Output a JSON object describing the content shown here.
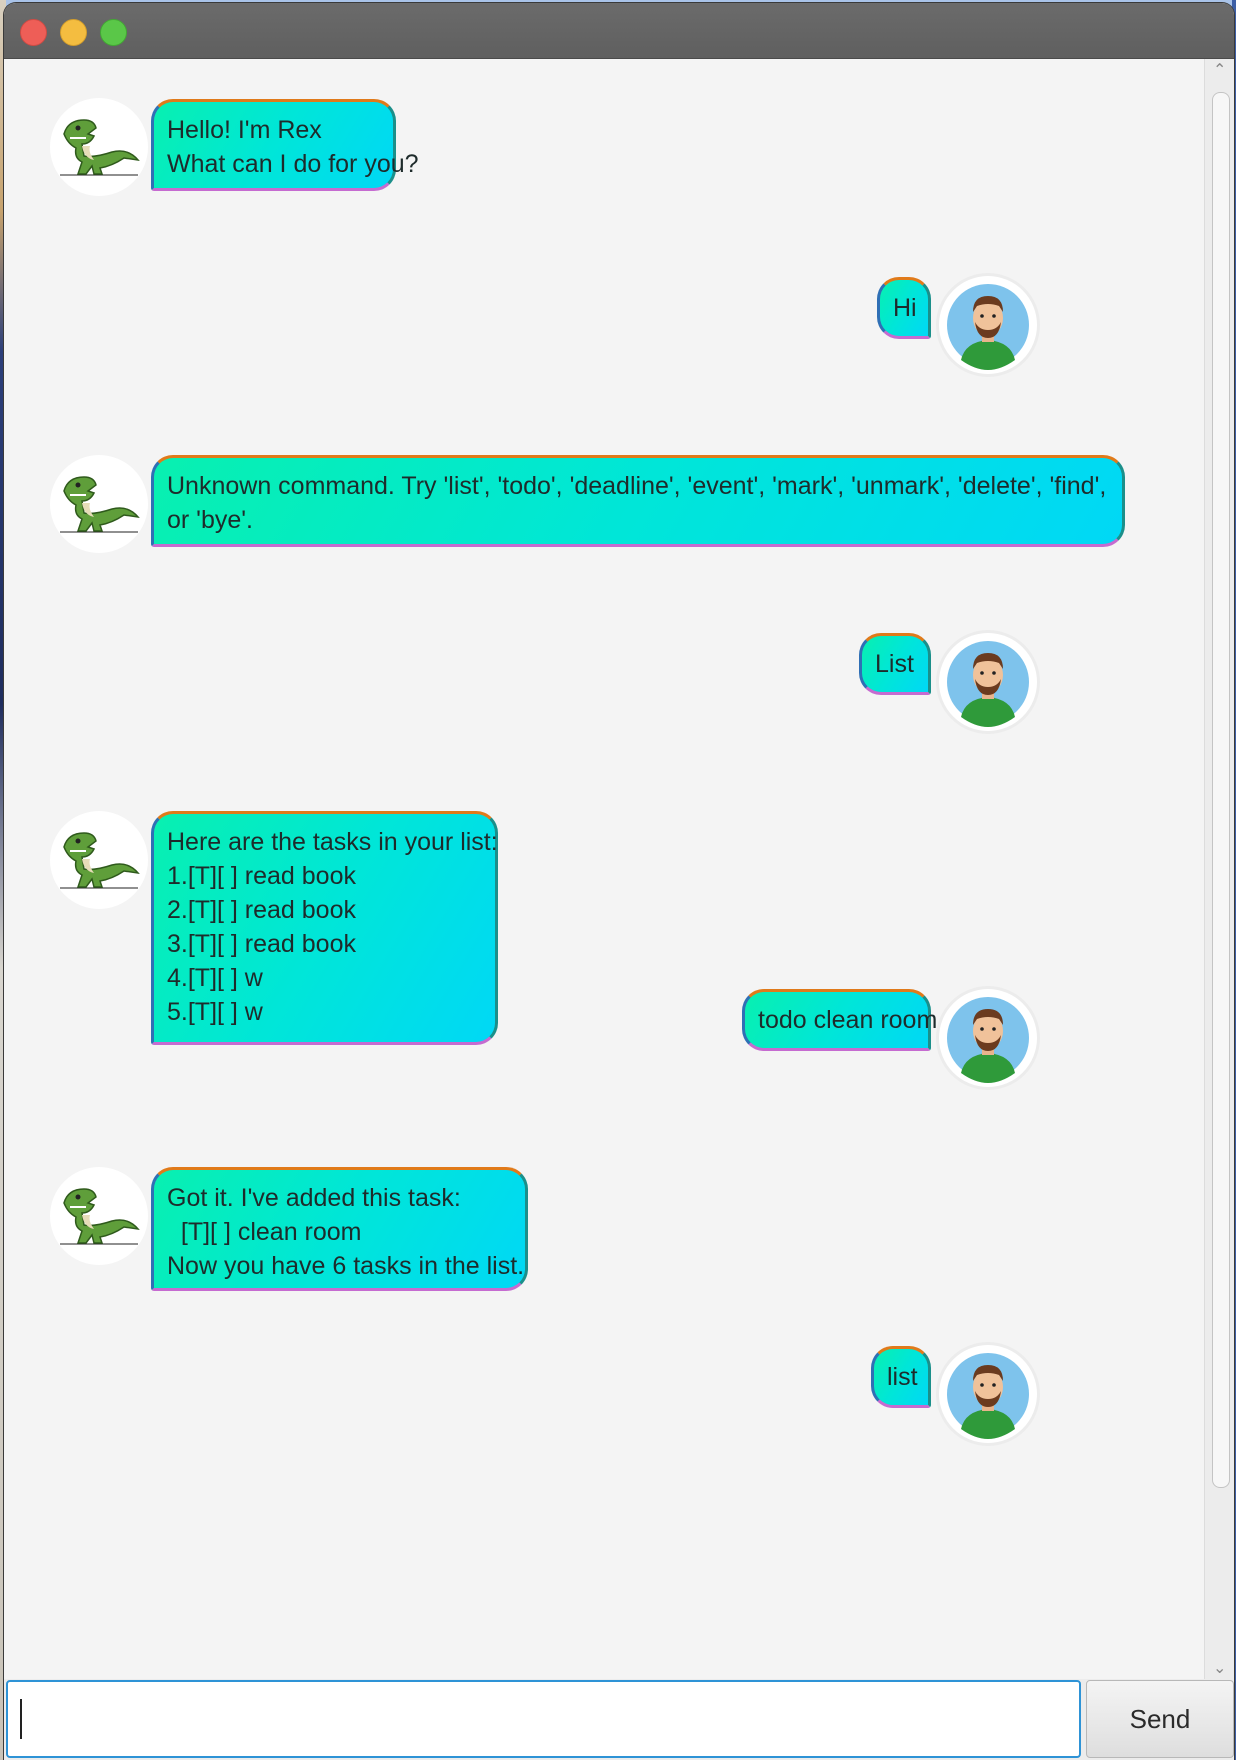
{
  "window": {
    "controls": [
      "close",
      "minimize",
      "zoom"
    ]
  },
  "chat": {
    "messages": [
      {
        "sender": "bot",
        "text": "Hello! I'm Rex\nWhat can I do for you?"
      },
      {
        "sender": "user",
        "text": "Hi"
      },
      {
        "sender": "bot",
        "text": "Unknown command. Try 'list', 'todo', 'deadline', 'event', 'mark', 'unmark', 'delete', 'find',\nor 'bye'."
      },
      {
        "sender": "user",
        "text": "List"
      },
      {
        "sender": "bot",
        "text": "Here are the tasks in your list:\n1.[T][ ] read book\n2.[T][ ] read book\n3.[T][ ] read book\n4.[T][ ] w\n5.[T][ ] w"
      },
      {
        "sender": "user",
        "text": "todo clean room"
      },
      {
        "sender": "bot",
        "text": "Got it. I've added this task:\n  [T][ ] clean room\nNow you have 6 tasks in the list."
      },
      {
        "sender": "user",
        "text": "list"
      }
    ],
    "bot_avatar": "dinosaur-icon",
    "user_avatar": "man-icon"
  },
  "input": {
    "value": "",
    "send_label": "Send"
  },
  "colors": {
    "bubble_gradient_start": "#08f0b0",
    "bubble_gradient_end": "#00d8f6",
    "input_focus_border": "#2e93d6",
    "background": "#f4f4f4"
  }
}
